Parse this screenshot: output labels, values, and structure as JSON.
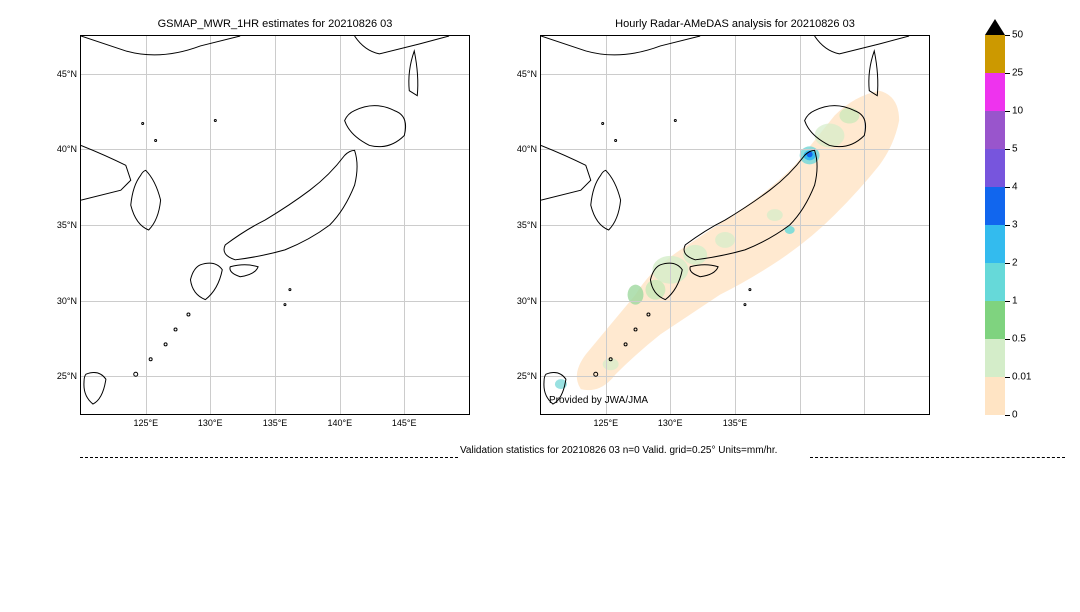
{
  "chart_data": [
    {
      "type": "heatmap",
      "title": "GSMAP_MWR_1HR estimates for 20210826 03",
      "xlabel": "",
      "ylabel": "",
      "x_ticks": [
        "125°E",
        "130°E",
        "135°E",
        "140°E",
        "145°E"
      ],
      "y_ticks": [
        "25°N",
        "30°N",
        "35°N",
        "40°N",
        "45°N"
      ],
      "xlim": [
        "120°E",
        "150°E"
      ],
      "ylim": [
        "22.5°N",
        "47.5°N"
      ],
      "description": "No precipitation data shown (empty estimate)",
      "region": "Japan and surrounding areas"
    },
    {
      "type": "heatmap",
      "title": "Hourly Radar-AMeDAS analysis for 20210826 03",
      "xlabel": "",
      "ylabel": "",
      "x_ticks": [
        "125°E",
        "130°E",
        "135°E"
      ],
      "y_ticks": [
        "25°N",
        "30°N",
        "35°N",
        "40°N",
        "45°N"
      ],
      "xlim": [
        "120°E",
        "150°E"
      ],
      "ylim": [
        "22.5°N",
        "47.5°N"
      ],
      "description": "Radar coverage area shown in pale orange (0-0.01 mm/hr range) covering Japanese archipelago. Scattered light precipitation (0.01-1 mm/hr, pale green) over Kyushu, Shikoku, western Honshu, and Hokkaido. Localized heavier precipitation (2-5 mm/hr, cyan/blue) near northern Tohoku/southern Hokkaido around 41°N 141°E.",
      "provided_by": "Provided by JWA/JMA",
      "region": "Japan and surrounding areas"
    }
  ],
  "colorbar": {
    "ticks": [
      0,
      0.01,
      0.5,
      1,
      2,
      3,
      4,
      5,
      10,
      25,
      50
    ],
    "colors": [
      "#ffe4c4",
      "#e6f5d0",
      "#b8e186",
      "#7fd37f",
      "#66d9d9",
      "#33bbee",
      "#1166ee",
      "#6633cc",
      "#9955cc",
      "#ee33ee",
      "#cc9900"
    ],
    "units": "mm/hr"
  },
  "validation_text": "Validation statistics for 20210826 03  n=0 Valid. grid=0.25° Units=mm/hr.",
  "titles": {
    "left": "GSMAP_MWR_1HR estimates for 20210826 03",
    "right": "Hourly Radar-AMeDAS analysis for 20210826 03"
  },
  "y_axis": {
    "labels": [
      "45°N",
      "40°N",
      "35°N",
      "30°N",
      "25°N"
    ],
    "positions_pct": [
      10,
      30,
      50,
      70,
      90
    ]
  },
  "x_axis_left": {
    "labels": [
      "125°E",
      "130°E",
      "135°E",
      "140°E",
      "145°E"
    ],
    "positions_pct": [
      16.7,
      33.3,
      50,
      66.7,
      83.3
    ]
  },
  "x_axis_right": {
    "labels": [
      "125°E",
      "130°E",
      "135°E"
    ],
    "positions_pct": [
      16.7,
      33.3,
      50
    ]
  },
  "provided_by": "Provided by JWA/JMA",
  "colorbar_labels": [
    "50",
    "25",
    "10",
    "5",
    "4",
    "3",
    "2",
    "1",
    "0.5",
    "0.01",
    "0"
  ],
  "colorbar_positions_pct": [
    0,
    10,
    20,
    30,
    40,
    50,
    60,
    70,
    80,
    90,
    100
  ]
}
